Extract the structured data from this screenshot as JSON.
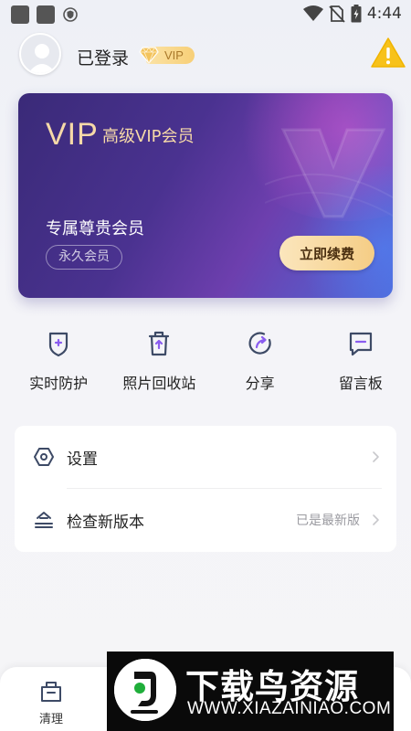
{
  "status_bar": {
    "time": "4:44",
    "icons": [
      "notification-square-icon",
      "notification-square-icon",
      "shield-icon",
      "wifi-icon",
      "no-sim-icon",
      "battery-charging-icon"
    ]
  },
  "header": {
    "username": "已登录",
    "vip_badge": "VIP",
    "warning_icon": "warning-icon"
  },
  "vip_card": {
    "logo": "VIP",
    "title": "高级VIP会员",
    "subtitle": "专属尊贵会员",
    "tag": "永久会员",
    "button": "立即续费",
    "colors": {
      "accent_gold": "#f6d9a8",
      "bg_start": "#3a2a78",
      "bg_end": "#4f68d8"
    }
  },
  "quick_actions": [
    {
      "label": "实时防护",
      "icon": "shield-plus-icon"
    },
    {
      "label": "照片回收站",
      "icon": "trash-icon"
    },
    {
      "label": "分享",
      "icon": "share-icon"
    },
    {
      "label": "留言板",
      "icon": "message-icon"
    }
  ],
  "settings": [
    {
      "label": "设置",
      "value": "",
      "icon": "settings-hex-icon"
    },
    {
      "label": "检查新版本",
      "value": "已是最新版",
      "icon": "upgrade-icon"
    }
  ],
  "bottom_nav": {
    "items": [
      {
        "label": "清理",
        "icon": "clean-box-icon"
      }
    ]
  },
  "watermark": {
    "title": "下载鸟资源",
    "url": "WWW.XIAZAINIAO.COM"
  }
}
